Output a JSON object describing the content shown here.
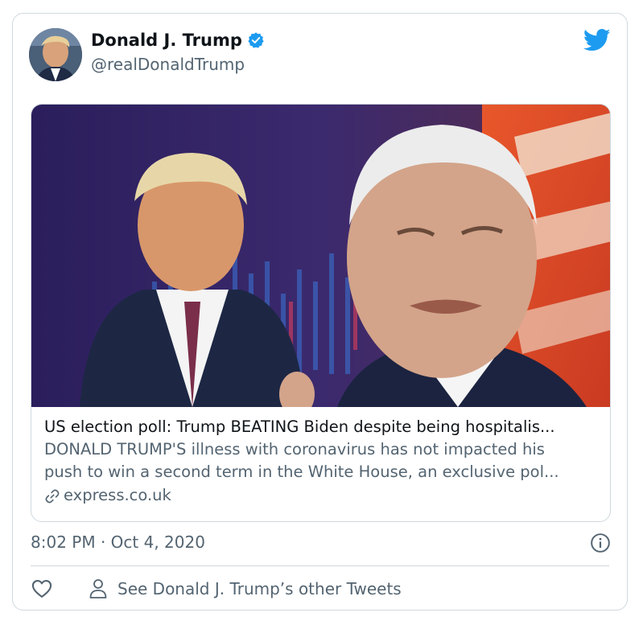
{
  "tweet": {
    "author_name": "Donald J. Trump",
    "author_handle": "@realDonaldTrump",
    "verified_icon": "verified-badge-icon",
    "platform_icon": "twitter-bird-icon",
    "timestamp": "8:02 PM · Oct 4, 2020"
  },
  "embed": {
    "title": "US election poll: Trump BEATING Biden despite being hospitalis...",
    "description_line1": "DONALD TRUMP'S illness with coronavirus has not impacted his",
    "description_line2": "push to win a second term in the White House, an exclusive pol...",
    "domain": "express.co.uk",
    "link_icon": "link-icon"
  },
  "footer": {
    "like_icon": "heart-icon",
    "person_icon": "person-icon",
    "other_tweets_label": "See Donald J. Trump’s other Tweets"
  },
  "colors": {
    "text_primary": "#0f1419",
    "text_secondary": "#536471",
    "twitter_blue": "#1d9bf0",
    "border": "#cfd9de"
  }
}
